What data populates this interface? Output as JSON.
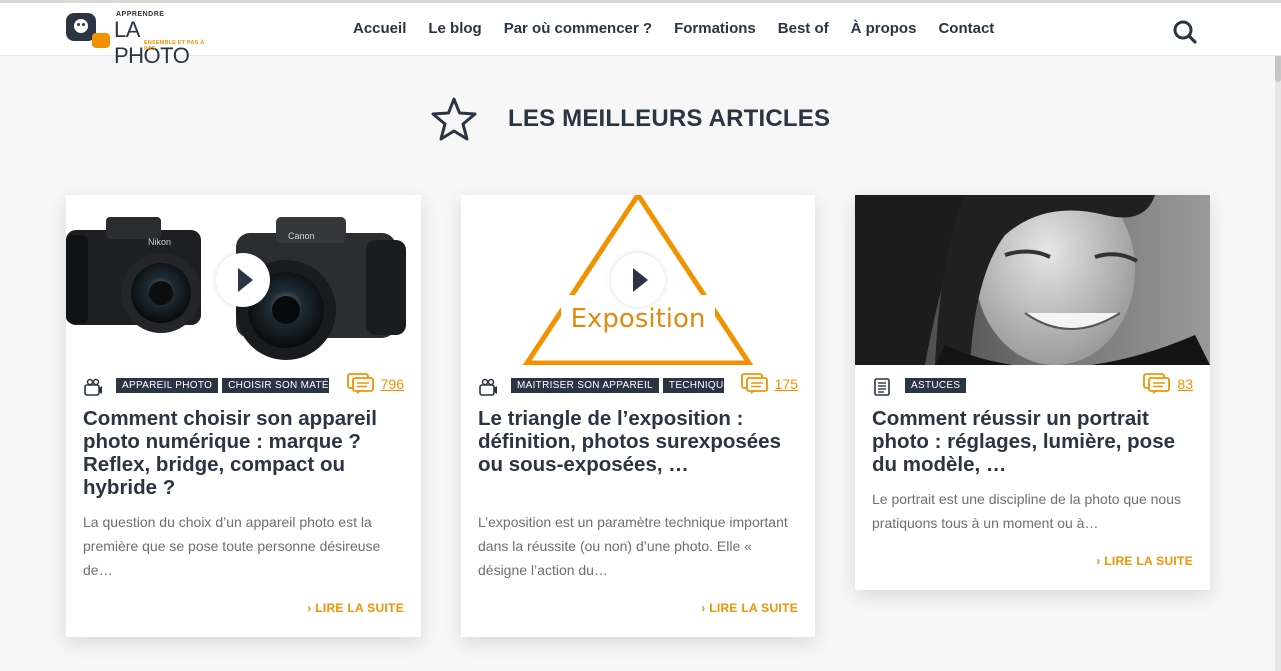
{
  "header": {
    "logo": {
      "top_text": "APPRENDRE",
      "main_text": "LA PHOTO",
      "tagline": "ENSEMBLE ET PAS À PAS"
    },
    "nav": [
      {
        "label": "Accueil"
      },
      {
        "label": "Le blog"
      },
      {
        "label": "Par où commencer ?"
      },
      {
        "label": "Formations"
      },
      {
        "label": "Best of"
      },
      {
        "label": "À propos"
      },
      {
        "label": "Contact"
      }
    ],
    "search_icon": "search-icon"
  },
  "section": {
    "icon": "star-icon",
    "title": "LES MEILLEURS ARTICLES"
  },
  "colors": {
    "navy": "#2a3443",
    "orange": "#f39200"
  },
  "cards": [
    {
      "type_icon": "video-camera-icon",
      "has_play": true,
      "tags": [
        "APPAREIL PHOTO",
        "CHOISIR SON MATÉRIEL"
      ],
      "comments": "796",
      "title": "Comment choisir son appareil photo numérique : marque ? Reflex, bridge, compact ou hybride ?",
      "excerpt": "La question du choix d’un appareil photo est la première que se pose toute personne désireuse de…",
      "more": "LIRE LA SUITE",
      "image_labels": [
        "Nikon",
        "Canon"
      ]
    },
    {
      "type_icon": "video-camera-icon",
      "has_play": true,
      "tags": [
        "MAITRISER SON APPAREIL",
        "TECHNIQUE PHOTO"
      ],
      "comments": "175",
      "title": "Le triangle de l’exposition : définition, photos surexposées ou sous-exposées, …",
      "excerpt": "L’exposition est un paramètre technique important dans la réussite (ou non) d’une photo. Elle « désigne l’action du…",
      "more": "LIRE LA SUITE",
      "image_text": "Exposition"
    },
    {
      "type_icon": "article-icon",
      "has_play": false,
      "tags": [
        "ASTUCES"
      ],
      "comments": "83",
      "title": "Comment réussir un portrait photo : réglages, lumière, pose du modèle, …",
      "excerpt": "Le portrait est une discipline de la photo que nous pratiquons tous à un moment ou à…",
      "more": "LIRE LA SUITE"
    }
  ]
}
